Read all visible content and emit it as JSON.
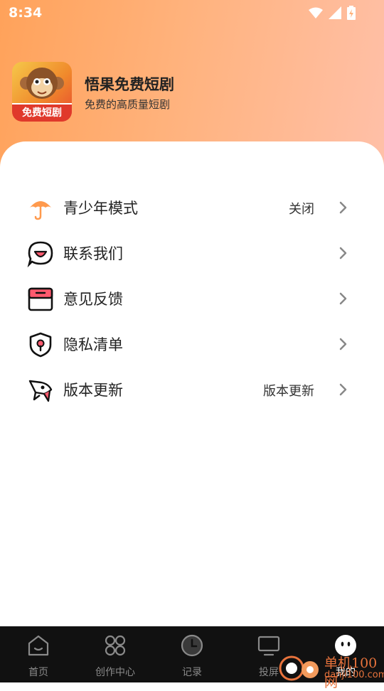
{
  "status_bar": {
    "time": "8:34"
  },
  "app": {
    "name": "悟果免费短剧",
    "subtitle": "免费的高质量短剧",
    "logo_text": "免费短剧"
  },
  "menu": [
    {
      "label": "青少年模式",
      "value": "关闭",
      "icon": "umbrella-icon"
    },
    {
      "label": "联系我们",
      "value": "",
      "icon": "chat-bubble-icon"
    },
    {
      "label": "意见反馈",
      "value": "",
      "icon": "mailbox-icon"
    },
    {
      "label": "隐私清单",
      "value": "",
      "icon": "shield-icon"
    },
    {
      "label": "版本更新",
      "value": "版本更新",
      "icon": "rocket-icon"
    }
  ],
  "tabbar": [
    {
      "label": "首页",
      "icon": "home-icon"
    },
    {
      "label": "创作中心",
      "icon": "grid-icon"
    },
    {
      "label": "记录",
      "icon": "clock-icon"
    },
    {
      "label": "投屏",
      "icon": "tv-icon"
    },
    {
      "label": "我的",
      "icon": "avatar-icon"
    }
  ],
  "watermark": {
    "text": "单机100网",
    "url": "danji100.com"
  },
  "colors": {
    "accent": "#ff9a4d",
    "tabbar_bg": "#111111",
    "text": "#222222"
  }
}
